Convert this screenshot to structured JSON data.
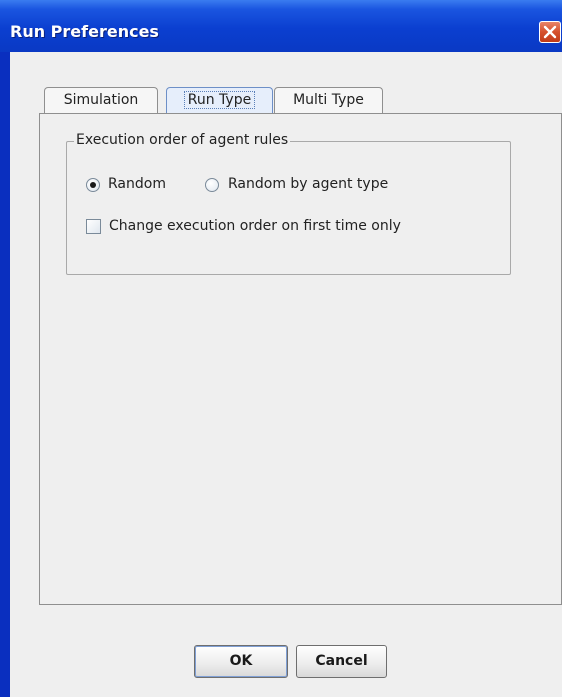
{
  "window": {
    "title": "Run Preferences",
    "close_icon": "close-icon",
    "colors": {
      "titlebar": "#0b3fd0",
      "close": "#d5502c",
      "client": "#efefef"
    }
  },
  "tabs": [
    {
      "label": "Simulation",
      "selected": false
    },
    {
      "label": "Run Type",
      "selected": true
    },
    {
      "label": "Multi Type",
      "selected": false
    }
  ],
  "execution_group": {
    "legend": "Execution order of agent rules",
    "options": [
      {
        "label": "Random",
        "checked": true
      },
      {
        "label": "Random by agent type",
        "checked": false
      }
    ],
    "checkbox": {
      "label": "Change execution order on first time only",
      "checked": false
    }
  },
  "buttons": {
    "ok_label": "OK",
    "cancel_label": "Cancel"
  }
}
